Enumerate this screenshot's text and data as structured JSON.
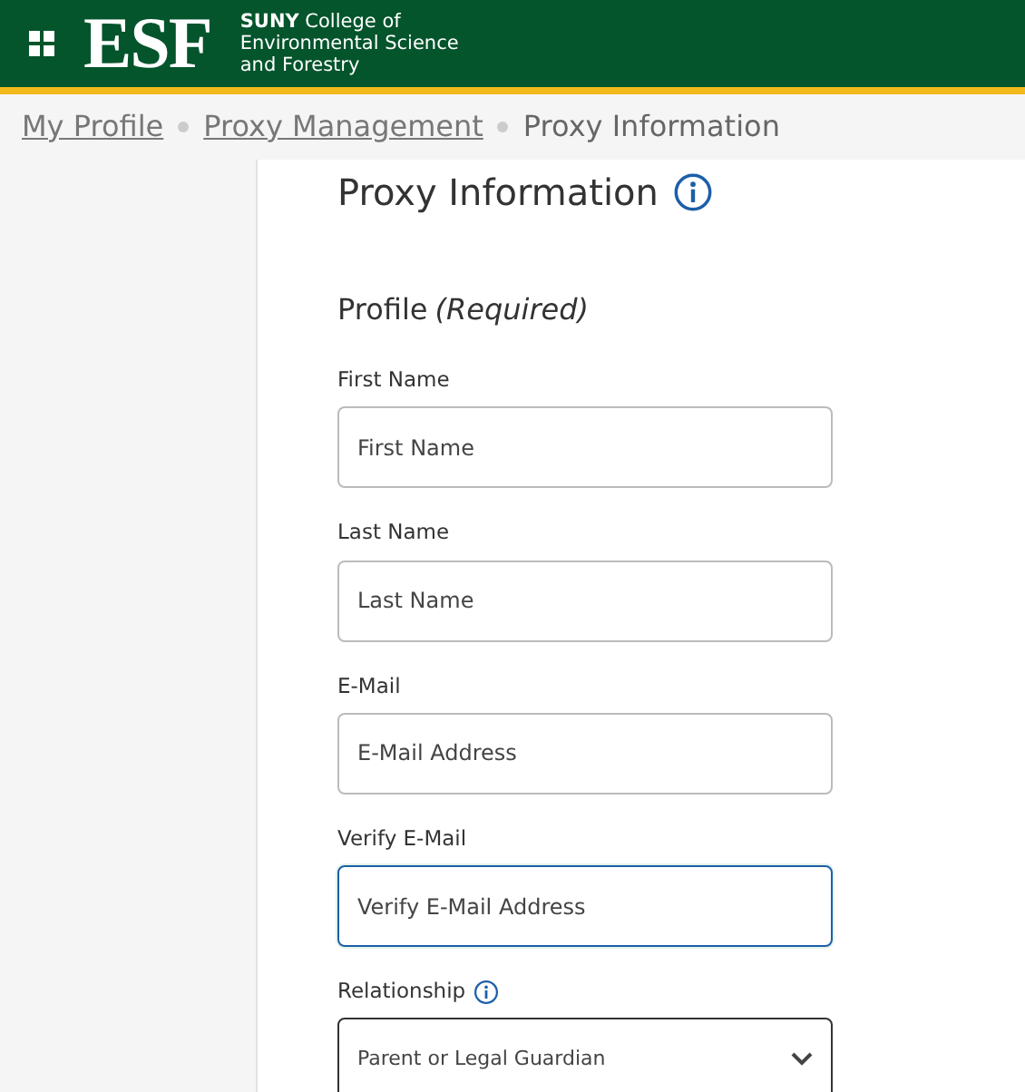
{
  "header": {
    "logo": "ESF",
    "logo_sub": [
      "**SUNY** College of",
      "Environmental Science",
      "and Forestry"
    ]
  },
  "breadcrumb": [
    {
      "label": "My Profile",
      "link": true
    },
    {
      "label": "Proxy Management",
      "link": true
    },
    {
      "label": "Proxy Information",
      "link": false
    }
  ],
  "page_title": "Proxy Information",
  "section": {
    "title": "Profile",
    "note": "(Required)"
  },
  "fields": [
    {
      "kind": "text",
      "label": "First Name",
      "placeholder": "First Name",
      "focused": false,
      "info": false
    },
    {
      "kind": "text",
      "label": "Last Name",
      "placeholder": "Last Name",
      "focused": false,
      "info": false
    },
    {
      "kind": "text",
      "label": "E-Mail",
      "placeholder": "E-Mail Address",
      "focused": false,
      "info": false
    },
    {
      "kind": "text",
      "label": "Verify E-Mail",
      "placeholder": "Verify E-Mail Address",
      "focused": true,
      "info": false
    },
    {
      "kind": "select",
      "label": "Relationship",
      "value": "Parent or Legal Guardian",
      "focused": false,
      "info": true
    }
  ]
}
